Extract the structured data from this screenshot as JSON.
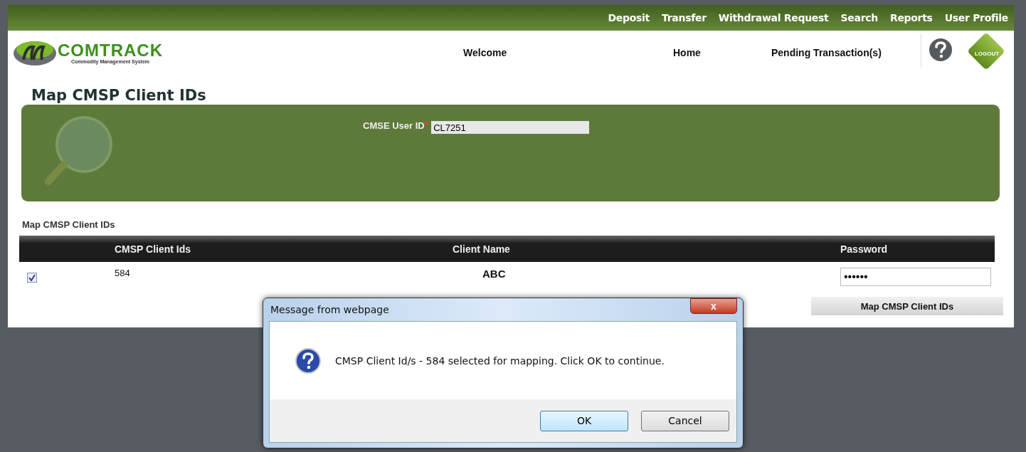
{
  "top_nav": [
    "Deposit",
    "Transfer",
    "Withdrawal Request",
    "Search",
    "Reports",
    "User Profile"
  ],
  "logo": {
    "name": "COMTRACK",
    "tagline": "Commodity Management System"
  },
  "header_nav": [
    "Welcome",
    "Home",
    "Pending Transaction(s)"
  ],
  "logout_label": "LOGOUT",
  "page_title": "Map CMSP Client IDs",
  "filter": {
    "label": "CMSE User ID",
    "required_mark": "*",
    "value": "CL7251"
  },
  "section_title": "Map CMSP Client IDs",
  "table": {
    "columns": [
      "CMSP Client Ids",
      "Client Name",
      "Password"
    ],
    "rows": [
      {
        "checked": true,
        "client_id": "584",
        "client_name": "ABC",
        "password": "••••••"
      }
    ]
  },
  "map_button": "Map CMSP Client IDs",
  "dialog": {
    "title": "Message from webpage",
    "close": "x",
    "message": "CMSP Client Id/s - 584 selected for mapping. Click OK to continue.",
    "buttons": [
      {
        "label": "OK",
        "selected": true
      },
      {
        "label": "Cancel",
        "selected": false
      }
    ]
  }
}
